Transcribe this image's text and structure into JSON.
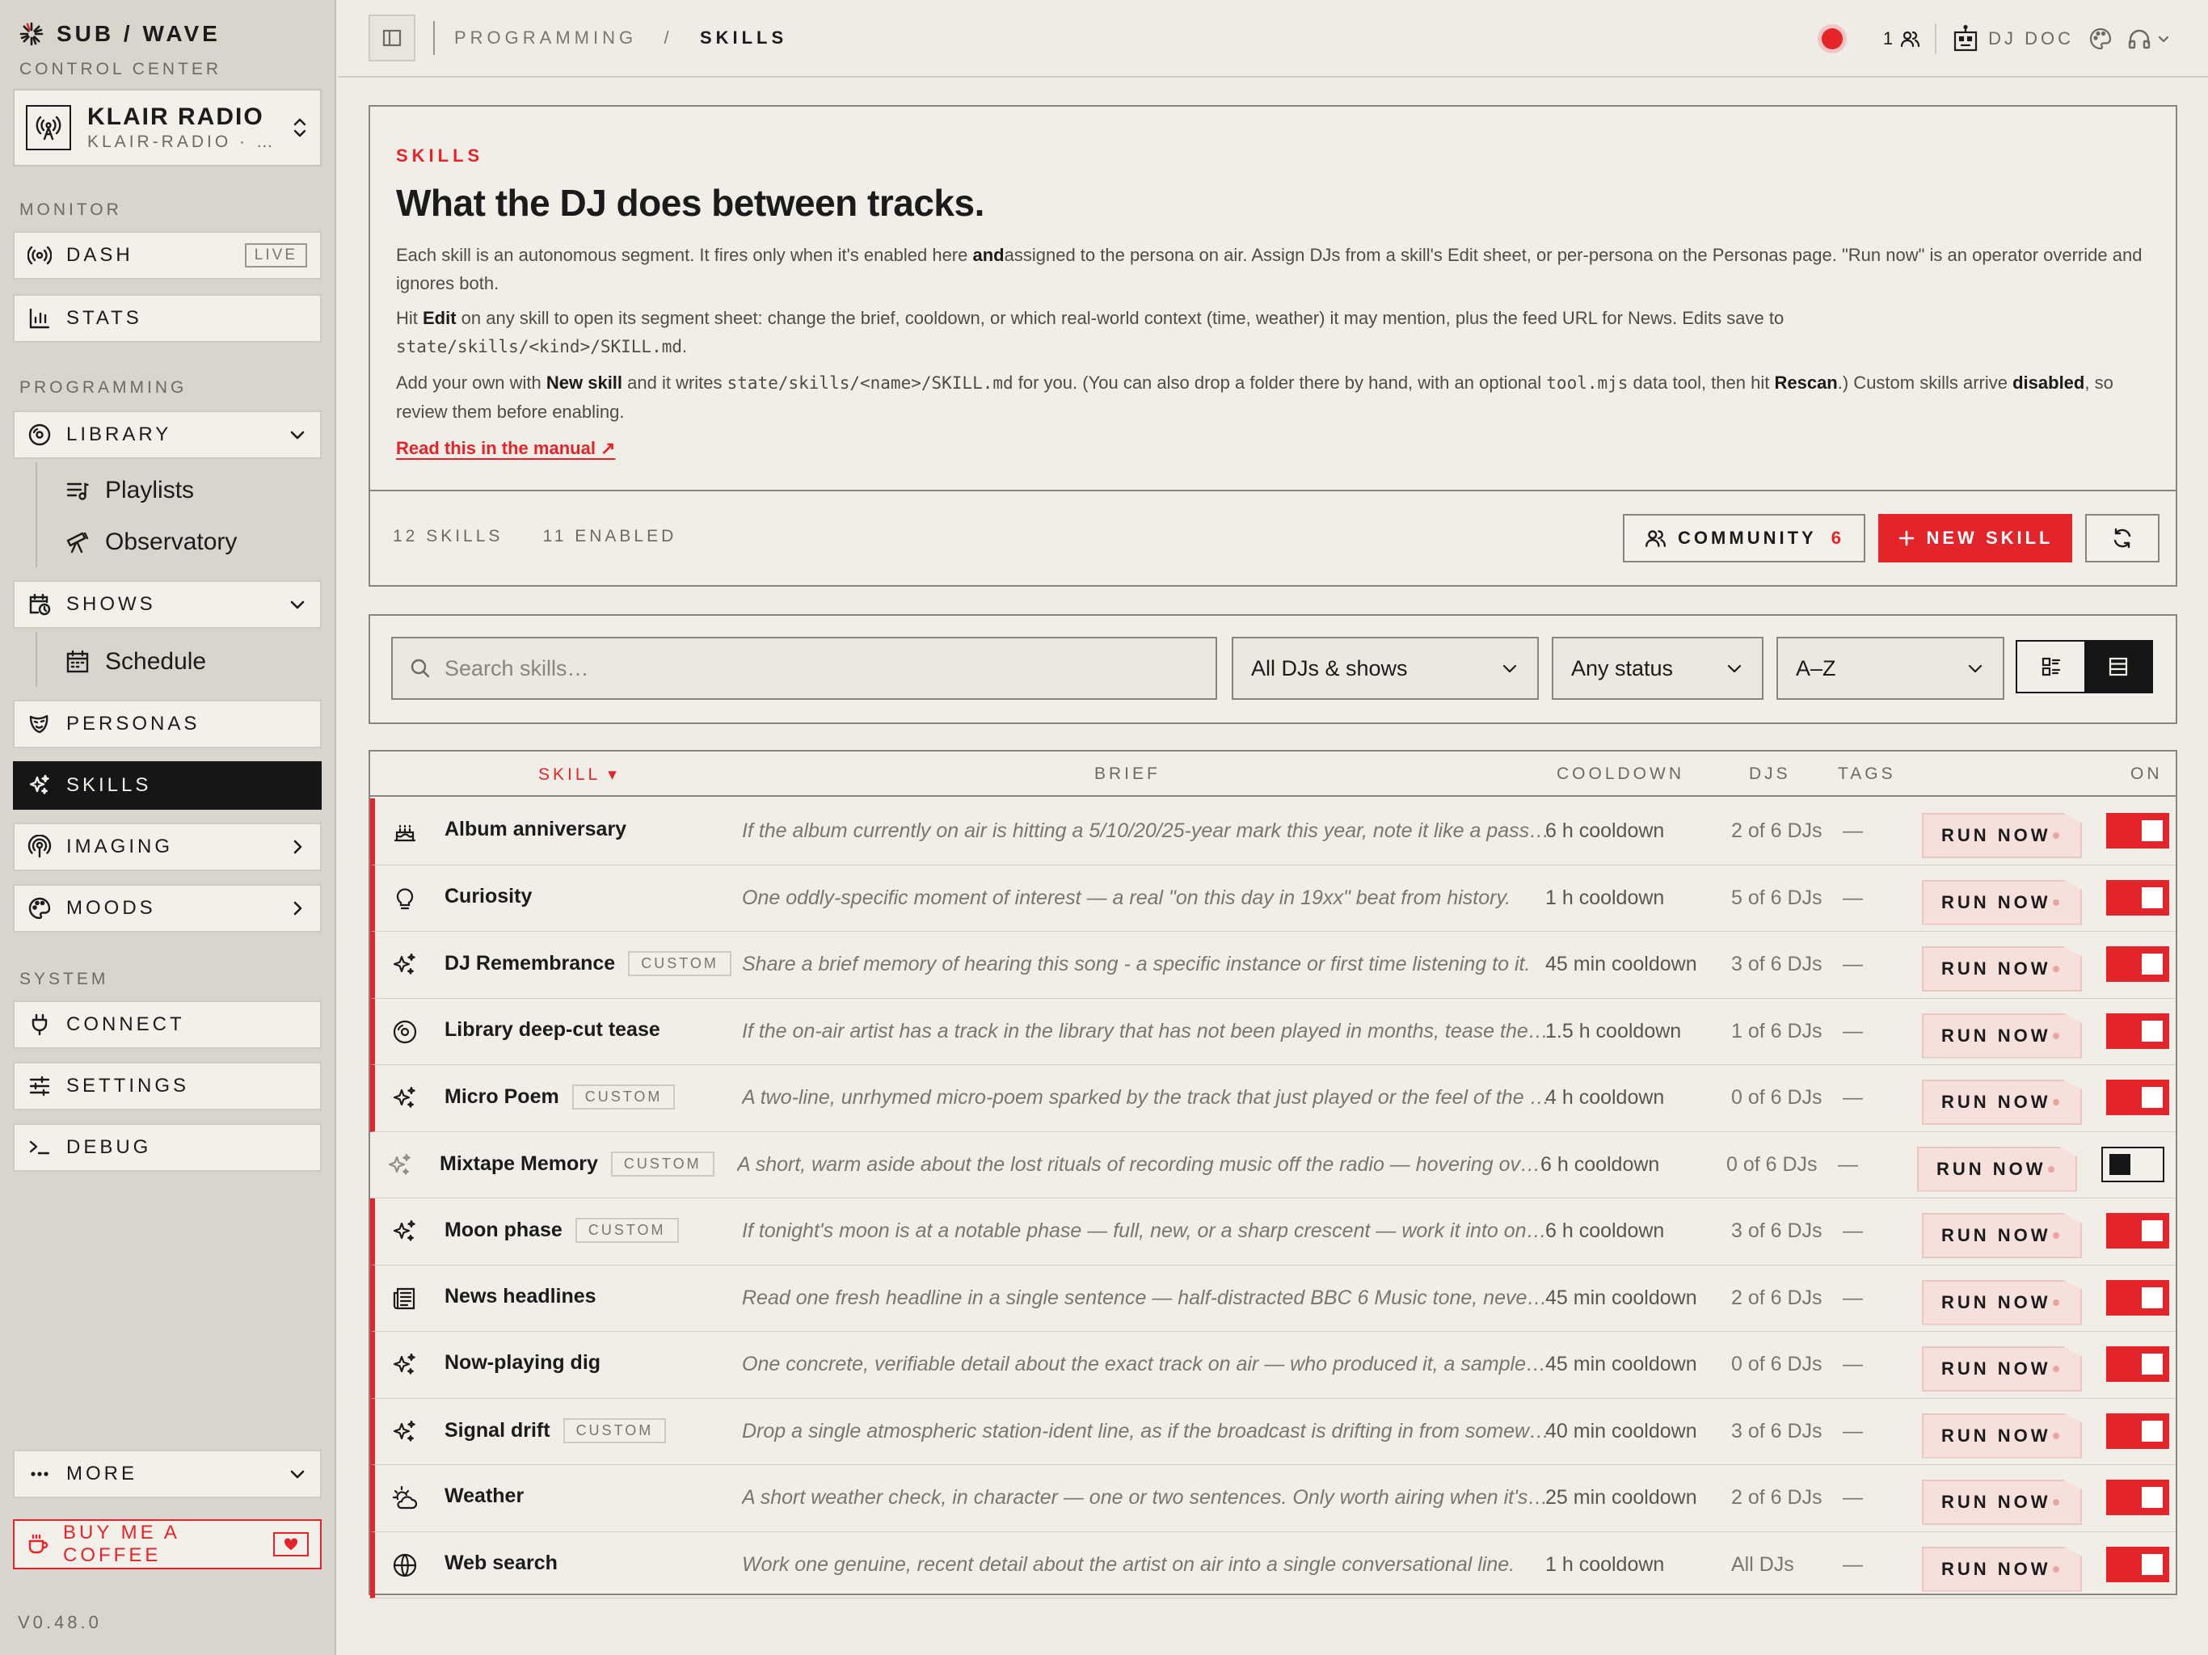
{
  "brand": {
    "name": "SUB / WAVE",
    "subtitle": "CONTROL CENTER"
  },
  "station": {
    "name": "KLAIR RADIO",
    "slug": "KLAIR-RADIO · …"
  },
  "sidebar": {
    "monitor_label": "MONITOR",
    "dash": "DASH",
    "live_badge": "LIVE",
    "stats": "STATS",
    "programming_label": "PROGRAMMING",
    "library": "LIBRARY",
    "playlists": "Playlists",
    "observatory": "Observatory",
    "shows": "SHOWS",
    "schedule": "Schedule",
    "personas": "PERSONAS",
    "skills": "SKILLS",
    "imaging": "IMAGING",
    "moods": "MOODS",
    "system_label": "SYSTEM",
    "connect": "CONNECT",
    "settings": "SETTINGS",
    "debug": "DEBUG",
    "more": "MORE",
    "coffee": "BUY ME A COFFEE",
    "version": "V0.48.0"
  },
  "topbar": {
    "crumb_parent": "PROGRAMMING",
    "crumb_sep": "/",
    "crumb_current": "SKILLS",
    "listeners": "1",
    "dj_name": "DJ DOC"
  },
  "intro": {
    "tag": "SKILLS",
    "headline": "What the DJ does between tracks.",
    "p1_a": "Each skill is an autonomous segment. It fires only when it's enabled here ",
    "p1_b": "and",
    "p1_c": "assigned to the persona on air. Assign DJs from a skill's Edit sheet, or per-persona on the Personas page. \"Run now\" is an operator override and ignores both.",
    "p2_a": "Hit ",
    "p2_b": "Edit",
    "p2_c": " on any skill to open its segment sheet: change the brief, cooldown, or which real-world context (time, weather) it may mention, plus the feed URL for News. Edits save to",
    "p2_code": "state/skills/<kind>/SKILL.md",
    "p2_d": ".",
    "p3_a": "Add your own with ",
    "p3_b": "New skill",
    "p3_c": " and it writes ",
    "p3_code1": "state/skills/<name>/SKILL.md",
    "p3_d": " for you. (You can also drop a folder there by hand, with an optional ",
    "p3_code2": "tool.mjs",
    "p3_e": " data tool, then hit ",
    "p3_f": "Rescan",
    "p3_g": ".) Custom skills arrive ",
    "p3_h": "disabled",
    "p3_i": ", so review them before enabling.",
    "manual": "Read this in the manual ↗",
    "count_skills": "12 SKILLS",
    "count_enabled": "11 ENABLED",
    "community": "COMMUNITY",
    "community_count": "6",
    "new_skill": "NEW SKILL"
  },
  "filters": {
    "search_placeholder": "Search skills…",
    "dj_filter": "All DJs & shows",
    "status_filter": "Any status",
    "sort": "A–Z"
  },
  "columns": {
    "skill": "SKILL ▾",
    "brief": "BRIEF",
    "cooldown": "COOLDOWN",
    "djs": "DJS",
    "tags": "TAGS",
    "on": "ON"
  },
  "run_label": "RUN NOW",
  "custom_label": "CUSTOM",
  "accent": "#e3242b",
  "skills": [
    {
      "name": "Album anniversary",
      "icon": "cake-icon",
      "custom": false,
      "brief": "If the album currently on air is hitting a 5/10/20/25-year mark this year, note it like a passing aside.",
      "cooldown": "6 h cooldown",
      "djs": "2 of 6 DJs",
      "tags": "—",
      "on": true
    },
    {
      "name": "Curiosity",
      "icon": "lightbulb-icon",
      "custom": false,
      "brief": "One oddly-specific moment of interest — a real \"on this day in 19xx\" beat from history.",
      "cooldown": "1 h cooldown",
      "djs": "5 of 6 DJs",
      "tags": "—",
      "on": true
    },
    {
      "name": "DJ Remembrance",
      "icon": "sparkle-icon",
      "custom": true,
      "brief": "Share a brief memory of hearing this song - a specific instance or first time listening to it.",
      "cooldown": "45 min cooldown",
      "djs": "3 of 6 DJs",
      "tags": "—",
      "on": true
    },
    {
      "name": "Library deep-cut tease",
      "icon": "vinyl-icon",
      "custom": false,
      "brief": "If the on-air artist has a track in the library that has not been played in months, tease the deep cut.",
      "cooldown": "1.5 h cooldown",
      "djs": "1 of 6 DJs",
      "tags": "—",
      "on": true
    },
    {
      "name": "Micro Poem",
      "icon": "sparkle-icon",
      "custom": true,
      "brief": "A two-line, unrhymed micro-poem sparked by the track that just played or the feel of the hour.",
      "cooldown": "4 h cooldown",
      "djs": "0 of 6 DJs",
      "tags": "—",
      "on": true
    },
    {
      "name": "Mixtape Memory",
      "icon": "sparkle-icon",
      "custom": true,
      "brief": "A short, warm aside about the lost rituals of recording music off the radio — hovering over the pause button.",
      "cooldown": "6 h cooldown",
      "djs": "0 of 6 DJs",
      "tags": "—",
      "on": false
    },
    {
      "name": "Moon phase",
      "icon": "sparkle-icon",
      "custom": true,
      "brief": "If tonight's moon is at a notable phase — full, new, or a sharp crescent — work it into one line.",
      "cooldown": "6 h cooldown",
      "djs": "3 of 6 DJs",
      "tags": "—",
      "on": true
    },
    {
      "name": "News headlines",
      "icon": "newspaper-icon",
      "custom": false,
      "brief": "Read one fresh headline in a single sentence — half-distracted BBC 6 Music tone, never alarming.",
      "cooldown": "45 min cooldown",
      "djs": "2 of 6 DJs",
      "tags": "—",
      "on": true
    },
    {
      "name": "Now-playing dig",
      "icon": "sparkle-icon",
      "custom": false,
      "brief": "One concrete, verifiable detail about the exact track on air — who produced it, a sample, a session detail.",
      "cooldown": "45 min cooldown",
      "djs": "0 of 6 DJs",
      "tags": "—",
      "on": true
    },
    {
      "name": "Signal drift",
      "icon": "sparkle-icon",
      "custom": true,
      "brief": "Drop a single atmospheric station-ident line, as if the broadcast is drifting in from somewhere far off.",
      "cooldown": "40 min cooldown",
      "djs": "3 of 6 DJs",
      "tags": "—",
      "on": true
    },
    {
      "name": "Weather",
      "icon": "sun-cloud-icon",
      "custom": false,
      "brief": "A short weather check, in character — one or two sentences. Only worth airing when it's notable.",
      "cooldown": "25 min cooldown",
      "djs": "2 of 6 DJs",
      "tags": "—",
      "on": true
    },
    {
      "name": "Web search",
      "icon": "globe-icon",
      "custom": false,
      "brief": "Work one genuine, recent detail about the artist on air into a single conversational line.",
      "cooldown": "1 h cooldown",
      "djs": "All DJs",
      "tags": "—",
      "on": true
    }
  ]
}
